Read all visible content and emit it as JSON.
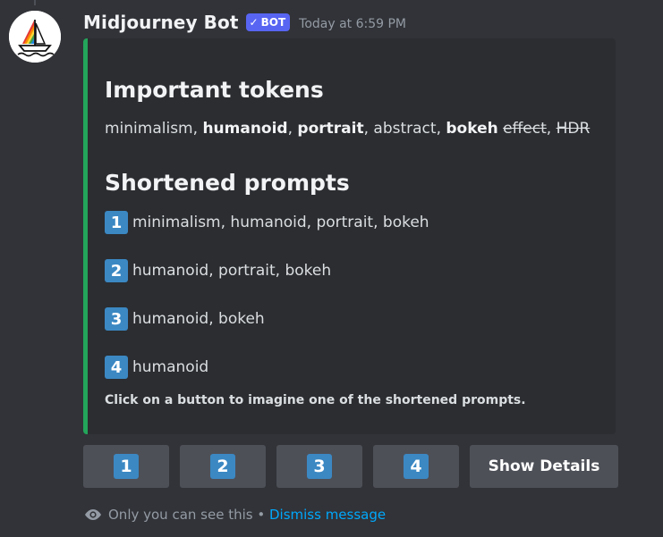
{
  "message": {
    "username": "Midjourney Bot",
    "bot_tag": "BOT",
    "bot_check": "✓",
    "timestamp": "Today at 6:59 PM"
  },
  "embed": {
    "accent_color": "#23a55a",
    "heading_tokens": "Important tokens",
    "tokens": {
      "t1": "minimalism",
      "sep1": ", ",
      "t2": "humanoid",
      "sep2": ", ",
      "t3": "portrait",
      "sep3": ", ",
      "t4": "abstract",
      "sep4": ", ",
      "t5": "bokeh",
      "space5": " ",
      "t6": "effect",
      "sep6": ", ",
      "t7": "HDR"
    },
    "heading_prompts": "Shortened prompts",
    "prompts": [
      {
        "num": "1",
        "text": "minimalism, humanoid, portrait, bokeh"
      },
      {
        "num": "2",
        "text": "humanoid, portrait, bokeh"
      },
      {
        "num": "3",
        "text": "humanoid, bokeh"
      },
      {
        "num": "4",
        "text": "humanoid"
      }
    ],
    "footer": "Click on a button to imagine one of the shortened prompts."
  },
  "buttons": {
    "b1": "1",
    "b2": "2",
    "b3": "3",
    "b4": "4",
    "details": "Show Details"
  },
  "ephemeral": {
    "notice": "Only you can see this",
    "separator": " • ",
    "dismiss": "Dismiss message"
  },
  "icons": {
    "avatar": "midjourney-boat-icon",
    "eye": "eye-icon"
  }
}
